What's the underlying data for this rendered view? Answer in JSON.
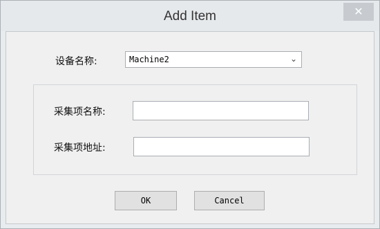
{
  "window": {
    "title": "Add Item",
    "close_glyph": "✕"
  },
  "form": {
    "device_name_label": "设备名称:",
    "device_name_value": "Machine2",
    "dropdown_arrow": "⌄",
    "item_name_label": "采集项名称:",
    "item_name_value": "",
    "item_address_label": "采集项地址:",
    "item_address_value": ""
  },
  "buttons": {
    "ok_label": "OK",
    "cancel_label": "Cancel"
  },
  "icons": {
    "close": "close-icon",
    "dropdown": "chevron-down-icon"
  },
  "colors": {
    "close_button_bg": "#c7cbd0",
    "dialog_bg": "#f0f0f0"
  }
}
